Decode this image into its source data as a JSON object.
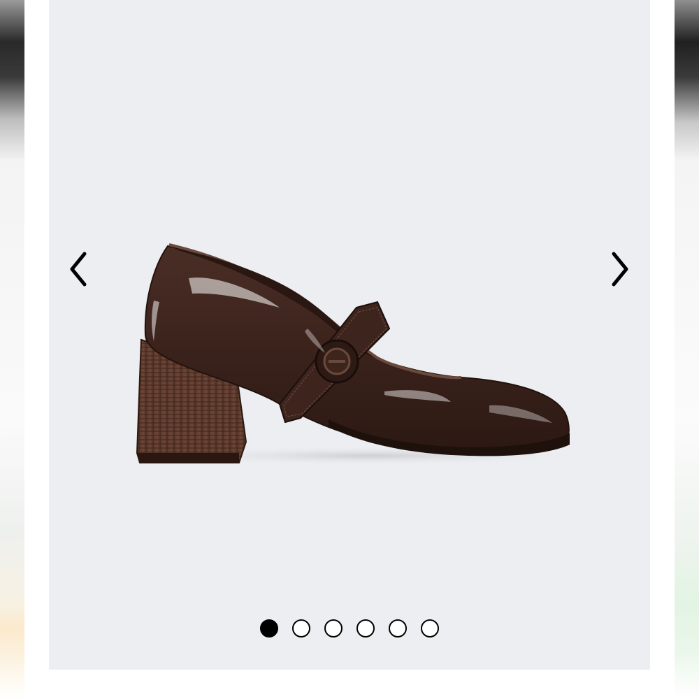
{
  "product_image": {
    "icon": "brown-patent-mary-jane-block-heel-shoe",
    "background_color": "#eceef2"
  },
  "carousel": {
    "prev_icon": "chevron-left-icon",
    "next_icon": "chevron-right-icon",
    "slide_count": 6,
    "active_index": 0
  }
}
